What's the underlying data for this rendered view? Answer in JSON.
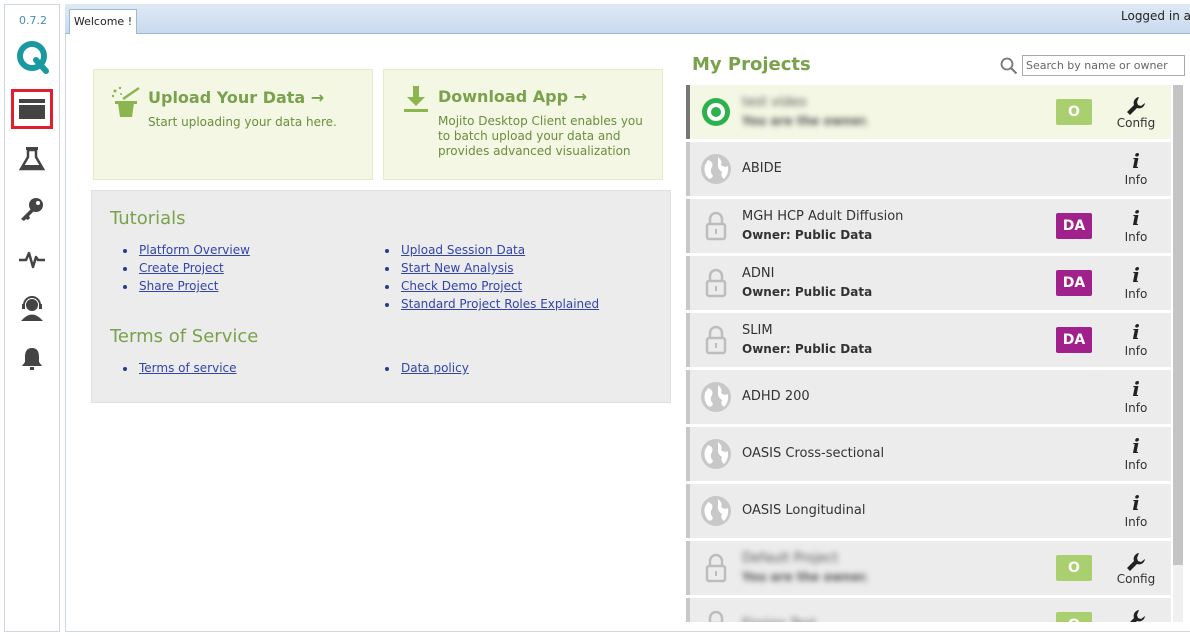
{
  "app": {
    "version": "0.7.2",
    "login_text": "Logged in as"
  },
  "tabs": [
    {
      "label": "Welcome !"
    }
  ],
  "cards": {
    "upload": {
      "title": "Upload Your Data →",
      "desc": "Start uploading your data here."
    },
    "download": {
      "title": "Download App →",
      "desc": "Mojito Desktop Client enables you to batch upload your data and provides advanced visualization"
    }
  },
  "tutorials": {
    "title": "Tutorials",
    "col1": [
      "Platform Overview",
      "Create Project",
      "Share Project"
    ],
    "col2": [
      "Upload Session Data",
      "Start New Analysis",
      "Check Demo Project",
      "Standard Project Roles Explained"
    ]
  },
  "terms": {
    "title": "Terms of Service",
    "col1": [
      "Terms of service"
    ],
    "col2": [
      "Data policy"
    ]
  },
  "projects": {
    "title": "My Projects",
    "search_placeholder": "Search by name or owner",
    "items": [
      {
        "name": "test video",
        "owner": "You are the owner.",
        "badge": "O",
        "badge_color": "#a9cf6e",
        "action": "Config",
        "icon": "target-icon",
        "blurred": true,
        "selected": true
      },
      {
        "name": "ABIDE",
        "owner": "",
        "badge": "",
        "action": "Info",
        "icon": "globe-icon",
        "blurred": false
      },
      {
        "name": "MGH HCP Adult Diffusion",
        "owner": "Owner: Public Data",
        "badge": "DA",
        "badge_color": "#a0208c",
        "action": "Info",
        "icon": "lock-icon",
        "blurred": false
      },
      {
        "name": "ADNI",
        "owner": "Owner: Public Data",
        "badge": "DA",
        "badge_color": "#a0208c",
        "action": "Info",
        "icon": "lock-icon",
        "blurred": false
      },
      {
        "name": "SLIM",
        "owner": "Owner: Public Data",
        "badge": "DA",
        "badge_color": "#a0208c",
        "action": "Info",
        "icon": "lock-icon",
        "blurred": false
      },
      {
        "name": "ADHD 200",
        "owner": "",
        "badge": "",
        "action": "Info",
        "icon": "globe-icon",
        "blurred": false
      },
      {
        "name": "OASIS Cross-sectional",
        "owner": "",
        "badge": "",
        "action": "Info",
        "icon": "globe-icon",
        "blurred": false
      },
      {
        "name": "OASIS Longitudinal",
        "owner": "",
        "badge": "",
        "action": "Info",
        "icon": "globe-icon",
        "blurred": false
      },
      {
        "name": "Default Project",
        "owner": "You are the owner.",
        "badge": "O",
        "badge_color": "#a9cf6e",
        "action": "Config",
        "icon": "lock-icon",
        "blurred": true
      },
      {
        "name": "Florian Test",
        "owner": "",
        "badge": "O",
        "badge_color": "#a9cf6e",
        "action": "Config",
        "icon": "lock-icon",
        "blurred": true
      }
    ]
  },
  "sidebar": {
    "items": [
      {
        "icon": "folder-icon",
        "active": true
      },
      {
        "icon": "flask-icon",
        "active": false
      },
      {
        "icon": "key-icon",
        "active": false
      },
      {
        "icon": "pulse-icon",
        "active": false
      },
      {
        "icon": "support-agent-icon",
        "active": false
      },
      {
        "icon": "bell-icon",
        "active": false
      }
    ]
  }
}
